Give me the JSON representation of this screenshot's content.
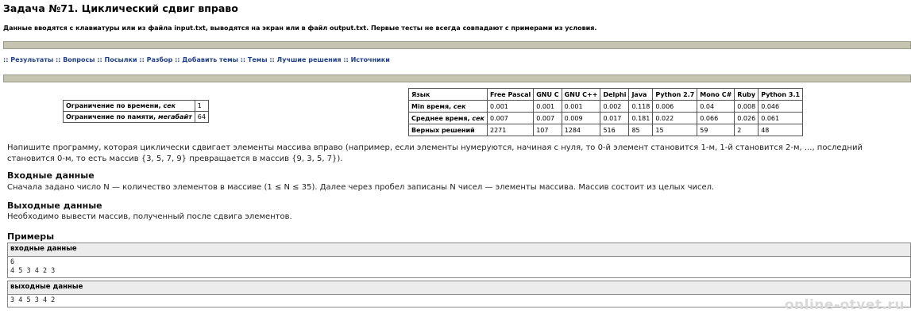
{
  "page": {
    "title": "Задача №71. Циклический сдвиг вправо",
    "io_note": "Данные вводятся с клавиатуры или из файла input.txt, выводятся на экран или в файл output.txt. Первые тесты не всегда совпадают с примерами из условия."
  },
  "nav": {
    "separator": "::",
    "links": [
      "Результаты",
      "Вопросы",
      "Посылки",
      "Разбор",
      "Добавить темы",
      "Темы",
      "Лучшие решения",
      "Источники"
    ]
  },
  "limits": {
    "time_label": "Ограничение по времени,",
    "time_unit": "сек",
    "time_value": "1",
    "memory_label": "Ограничение по памяти,",
    "memory_unit": "мегабайт",
    "memory_value": "64"
  },
  "stats": {
    "header": [
      "Язык",
      "Free Pascal",
      "GNU C",
      "GNU C++",
      "Delphi",
      "Java",
      "Python 2.7",
      "Mono C#",
      "Ruby",
      "Python 3.1"
    ],
    "rows": [
      {
        "label": "Min время,",
        "unit": "сек",
        "values": [
          "0.001",
          "0.001",
          "0.001",
          "0.002",
          "0.118",
          "0.006",
          "0.04",
          "0.008",
          "0.046"
        ]
      },
      {
        "label": "Среднее время,",
        "unit": "сек",
        "values": [
          "0.007",
          "0.007",
          "0.009",
          "0.017",
          "0.181",
          "0.022",
          "0.066",
          "0.026",
          "0.061"
        ]
      },
      {
        "label": "Верных решений",
        "unit": "",
        "values": [
          "2271",
          "107",
          "1284",
          "516",
          "85",
          "15",
          "59",
          "2",
          "48"
        ]
      }
    ]
  },
  "statement": {
    "text": "Напишите программу, которая циклически сдвигает элементы массива вправо (например, если элементы нумеруются, начиная с нуля, то 0-й элемент становится 1-м, 1-й становится 2-м, ..., последний становится 0-м, то есть массив {3, 5, 7, 9} превращается в массив {9, 3, 5, 7}).",
    "input_heading": "Входные данные",
    "input_text": "Сначала задано число N — количество элементов в массиве (1 ≤ N ≤ 35). Далее через пробел записаны N чисел — элементы массива. Массив состоит из целых чисел.",
    "output_heading": "Выходные данные",
    "output_text": "Необходимо вывести массив, полученный после сдвига элементов.",
    "examples_heading": "Примеры"
  },
  "example": {
    "input_label": "входные данные",
    "input_line1": "6",
    "input_line2": "4 5 3 4 2 3",
    "output_label": "выходные данные",
    "output_line1": "3 4 5 3 4 2"
  },
  "watermark": "online-otvet.ru",
  "colors": {
    "link": "#1e3f8f",
    "bar": "#c4c4b0",
    "example_header": "#ececec"
  }
}
